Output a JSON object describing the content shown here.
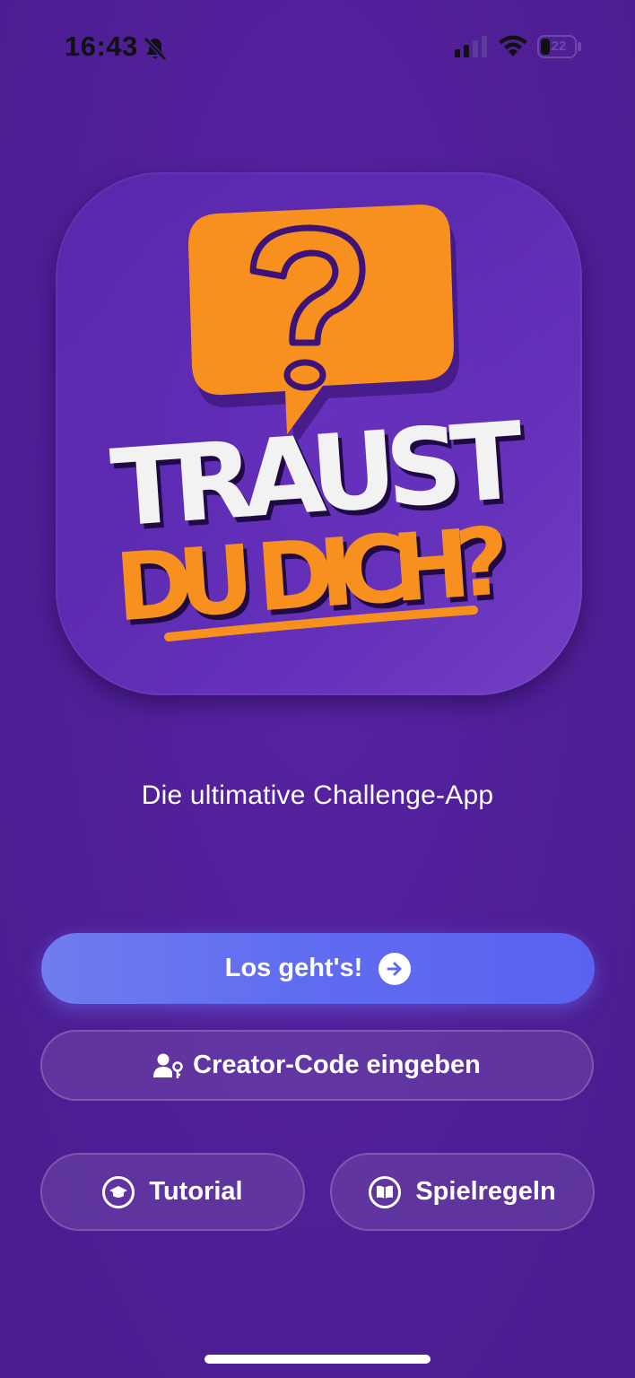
{
  "status_bar": {
    "time": "16:43",
    "battery_level": "22",
    "icons": [
      "bell-off-icon",
      "cellular-signal-icon",
      "wifi-icon",
      "battery-icon"
    ]
  },
  "logo": {
    "line1": "TRAUST",
    "line2": "DU DICH?",
    "symbol": "?",
    "colors": {
      "orange": "#f7901e",
      "white": "#f2f2f2",
      "tile": "#5f2cb6"
    }
  },
  "tagline": "Die ultimative Challenge-App",
  "buttons": {
    "start": {
      "label": "Los geht's!",
      "icon": "arrow-right-circle-icon"
    },
    "creator_code": {
      "label": "Creator-Code eingeben",
      "icon": "user-key-icon"
    },
    "tutorial": {
      "label": "Tutorial",
      "icon": "graduation-cap-icon"
    },
    "rules": {
      "label": "Spielregeln",
      "icon": "book-icon"
    }
  },
  "colors": {
    "background": "#4f1f96",
    "primary_button": "#5f6bf0",
    "accent_orange": "#f7901e"
  }
}
